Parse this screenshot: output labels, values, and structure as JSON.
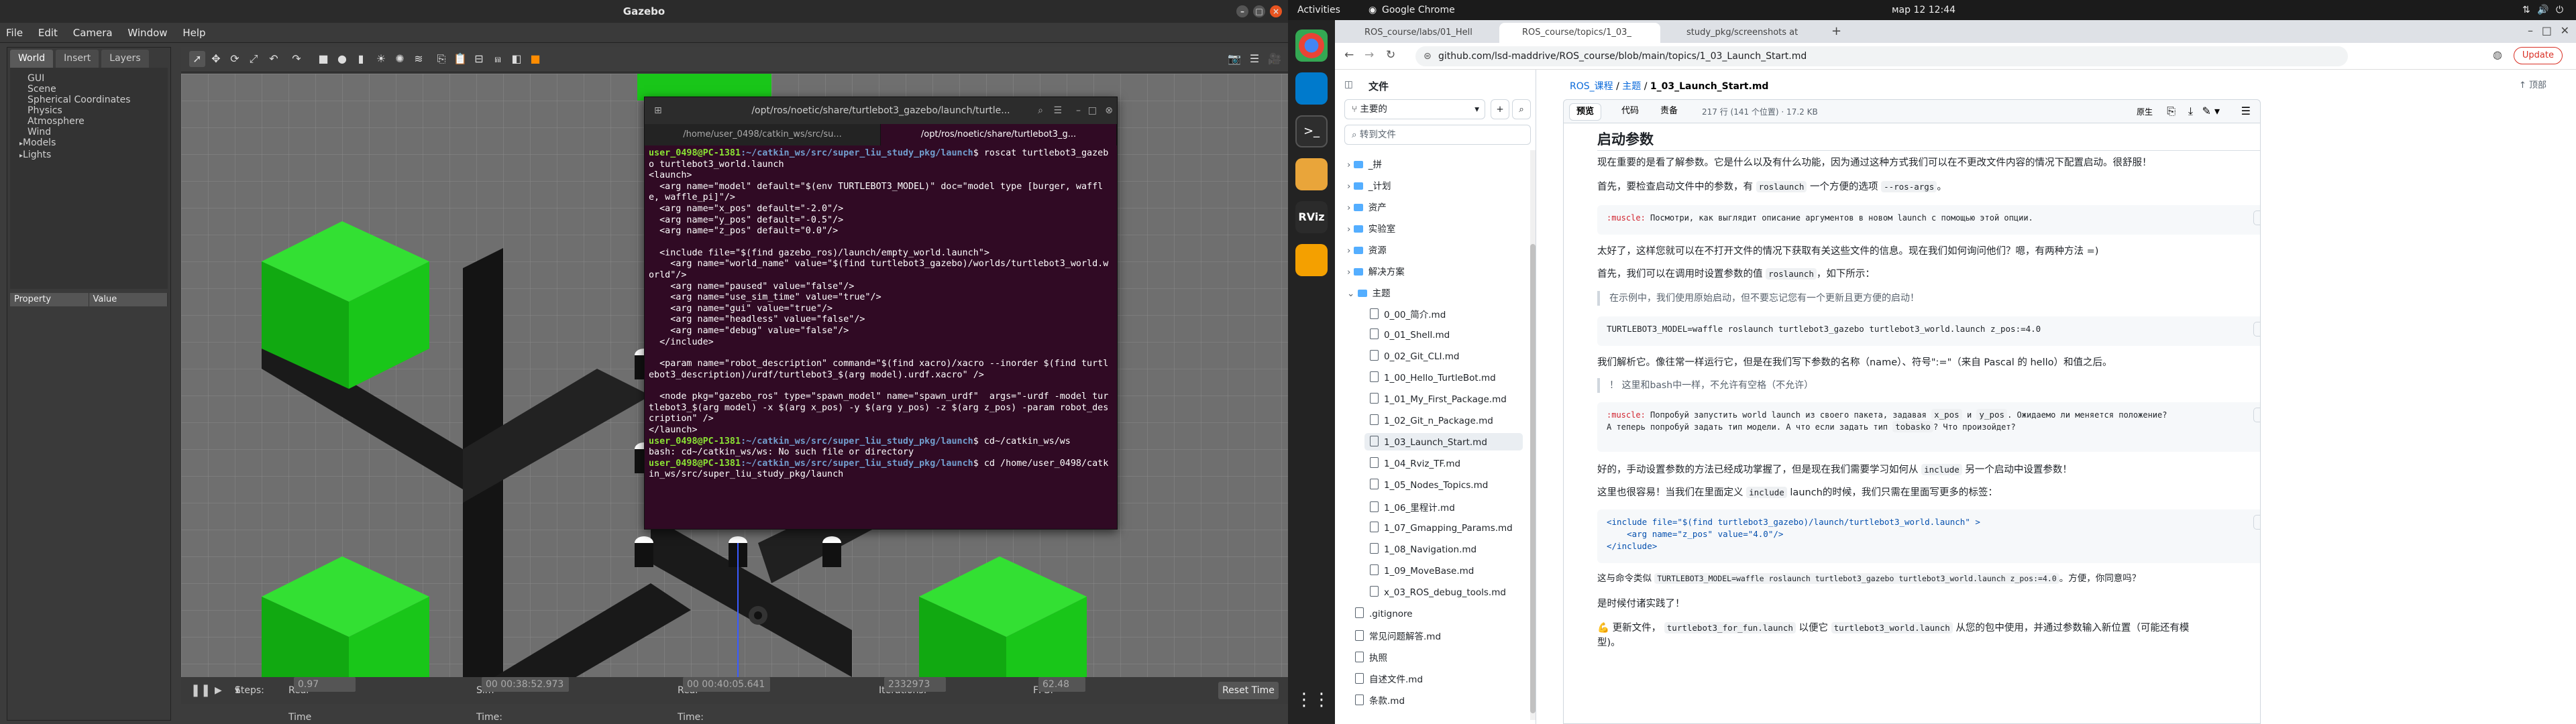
{
  "gazebo": {
    "title": "Gazebo",
    "menu": [
      "File",
      "Edit",
      "Camera",
      "Window",
      "Help"
    ],
    "tabs": [
      "World",
      "Insert",
      "Layers"
    ],
    "tree": [
      "GUI",
      "Scene",
      "Spherical Coordinates",
      "Physics",
      "Atmosphere",
      "Wind",
      "Models",
      "Lights"
    ],
    "prop_headers": [
      "Property",
      "Value"
    ],
    "bottom": {
      "steps_label": "Steps:",
      "steps": "1",
      "rtf_label": "Real Time Factor:",
      "rtf": "0.97",
      "sim_label": "Sim Time:",
      "sim": "00 00:38:52.973",
      "real_label": "Real Time:",
      "real": "00 00:40:05.641",
      "iter_label": "Iterations:",
      "iter": "2332973",
      "fps_label": "FPS:",
      "fps": "62.48",
      "reset": "Reset Time"
    },
    "colors": {
      "cube": "#19c619",
      "floor": "#707070"
    }
  },
  "terminal": {
    "title": "/opt/ros/noetic/share/turtlebot3_gazebo/launch/turtle...",
    "tabs": [
      "/home/user_0498/catkin_ws/src/su...",
      "/opt/ros/noetic/share/turtlebot3_g..."
    ],
    "lines": [
      {
        "u": "user_0498@PC-1381",
        "p": ":~/catkin_ws/src/super_liu_study_pkg/launch",
        "c": "$ roscat turtlebot3_gazebo turtlebot3_world.launch"
      },
      {
        "t": "<launch>"
      },
      {
        "t": "  <arg name=\"model\" default=\"$(env TURTLEBOT3_MODEL)\" doc=\"model type [burger, waffle, waffle_pi]\"/>"
      },
      {
        "t": "  <arg name=\"x_pos\" default=\"-2.0\"/>"
      },
      {
        "t": "  <arg name=\"y_pos\" default=\"-0.5\"/>"
      },
      {
        "t": "  <arg name=\"z_pos\" default=\"0.0\"/>"
      },
      {
        "t": ""
      },
      {
        "t": "  <include file=\"$(find gazebo_ros)/launch/empty_world.launch\">"
      },
      {
        "t": "    <arg name=\"world_name\" value=\"$(find turtlebot3_gazebo)/worlds/turtlebot3_world.world\"/>"
      },
      {
        "t": "    <arg name=\"paused\" value=\"false\"/>"
      },
      {
        "t": "    <arg name=\"use_sim_time\" value=\"true\"/>"
      },
      {
        "t": "    <arg name=\"gui\" value=\"true\"/>"
      },
      {
        "t": "    <arg name=\"headless\" value=\"false\"/>"
      },
      {
        "t": "    <arg name=\"debug\" value=\"false\"/>"
      },
      {
        "t": "  </include>"
      },
      {
        "t": ""
      },
      {
        "t": "  <param name=\"robot_description\" command=\"$(find xacro)/xacro --inorder $(find turtlebot3_description)/urdf/turtlebot3_$(arg model).urdf.xacro\" />"
      },
      {
        "t": ""
      },
      {
        "t": "  <node pkg=\"gazebo_ros\" type=\"spawn_model\" name=\"spawn_urdf\"  args=\"-urdf -model turtlebot3_$(arg model) -x $(arg x_pos) -y $(arg y_pos) -z $(arg z_pos) -param robot_description\" />"
      },
      {
        "t": "</launch>"
      },
      {
        "u": "user_0498@PC-1381",
        "p": ":~/catkin_ws/src/super_liu_study_pkg/launch",
        "c": "$ cd~/catkin_ws/ws"
      },
      {
        "t": "bash: cd~/catkin_ws/ws: No such file or directory"
      },
      {
        "u": "user_0498@PC-1381",
        "p": ":~/catkin_ws/src/super_liu_study_pkg/launch",
        "c": "$ cd /home/user_0498/catkin_ws/src/super_liu_study_pkg/launch"
      }
    ]
  },
  "ubuntu": {
    "activities": "Activities",
    "app": "Google Chrome",
    "clock": "мар 12  12:44"
  },
  "chrome": {
    "tabs": [
      "ROS_course/labs/01_Hell",
      "ROS_course/topics/1_03_",
      "study_pkg/screenshots at"
    ],
    "url": "github.com/lsd-maddrive/ROS_course/blob/main/topics/1_03_Launch_Start.md",
    "update": "Update",
    "sidebar": {
      "title": "文件",
      "branch": "主要的",
      "search": "转到文件",
      "folders": [
        "_拼",
        "_计划",
        "资产",
        "实验室",
        "资源",
        "解决方案",
        "主题"
      ],
      "topic_files": [
        "0_00_简介.md",
        "0_01_Shell.md",
        "0_02_Git_CLI.md",
        "1_00_Hello_TurtleBot.md",
        "1_01_My_First_Package.md",
        "1_02_Git_n_Package.md",
        "1_03_Launch_Start.md",
        "1_04_Rviz_TF.md",
        "1_05_Nodes_Topics.md",
        "1_06_里程计.md",
        "1_07_Gmapping_Params.md",
        "1_08_Navigation.md",
        "1_09_MoveBase.md",
        "x_03_ROS_debug_tools.md"
      ],
      "root_files": [
        ".gitignore",
        "常见问题解答.md",
        "执照",
        "自述文件.md",
        "条款.md"
      ]
    },
    "breadcrumb": {
      "repo": "ROS_课程",
      "sep": "/",
      "folder": "主题",
      "file": "1_03_Launch_Start.md"
    },
    "top_btn": "顶部",
    "view_tabs": [
      "预览",
      "代码",
      "责备"
    ],
    "meta": "217 行 (141 个位置) · 17.2 KB",
    "raw": "原生",
    "content": {
      "heading": "启动参数",
      "p1": "现在重要的是看了解参数。它是什么以及有什么功能，因为通过这种方式我们可以在不更改文件内容的情况下配置启动。很舒服！",
      "p2a": "首先，要检查启动文件中的参数，有",
      "p2code1": "roslaunch",
      "p2b": "一个方便的选项",
      "p2code2": "--ros-args",
      "p2c": "。",
      "muscle1_tag": ":muscle:",
      "muscle1": "Посмотри, как выглядит описание аргументов в новом launch с помощью этой опции.",
      "p3": "太好了，这样您就可以在不打开文件的情况下获取有关这些文件的信息。现在我们如何询问他们？嗯，有两种方法 =)",
      "p4a": "首先，我们可以在调用时设置参数的值",
      "p4code": "roslaunch",
      "p4b": "，如下所示：",
      "quote1": "在示例中，我们使用原始启动，但不要忘记您有一个更新且更方便的启动！",
      "code1": "TURTLEBOT3_MODEL=waffle roslaunch turtlebot3_gazebo turtlebot3_world.launch z_pos:=4.0",
      "p5": "我们解析它。像往常一样运行它，但是在我们写下参数的名称（name）、符号\":=\"（来自 Pascal 的 hello）和值之后。",
      "quote2": "！ 这里和bash中一样，不允许有空格（不允许）",
      "muscle2_tag": ":muscle:",
      "muscle2a": "Попробуй запустить world launch из своего пакета, задавая",
      "muscle2c1": "x_pos",
      "muscle2b": "и",
      "muscle2c2": "y_pos",
      "muscle2d": ". Ожидаемо ли меняется положение?",
      "muscle2e": "А теперь попробуй задать тип модели. А что если задать тип",
      "muscle2c3": "tobasko",
      "muscle2f": "? Что произойдет?",
      "p6a": "好的，手动设置参数的方法已经成功掌握了，但是现在我们需要学习如何从",
      "p6code": "include",
      "p6b": "另一个启动中设置参数！",
      "p7a": "这里也很容易！当我们在里面定义",
      "p7code": "include",
      "p7b": "launch的时候，我们只需在里面写更多的标签：",
      "code2": [
        "<include file=\"$(find turtlebot3_gazebo)/launch/turtlebot3_world.launch\" >",
        "    <arg name=\"z_pos\" value=\"4.0\"/>",
        "</include>"
      ],
      "p8a": "这与命令类似",
      "p8code": "TURTLEBOT3_MODEL=waffle roslaunch turtlebot3_gazebo turtlebot3_world.launch z_pos:=4.0",
      "p8b": "。方便，你同意吗？",
      "p9": "是时候付诸实践了！",
      "p10a": "💪 更新文件，",
      "p10code1": "turtlebot3_for_fun.launch",
      "p10b": "以便它",
      "p10code2": "turtlebot3_world.launch",
      "p10c": "从您的包中使用，并通过参数输入新位置（可能还有模",
      "p10d": "型)。"
    }
  }
}
